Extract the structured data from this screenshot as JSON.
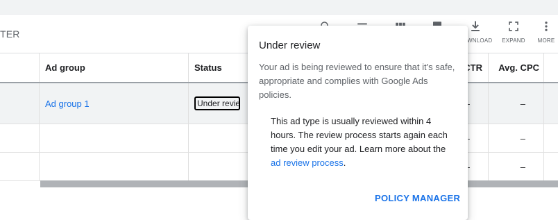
{
  "toolbar": {
    "filter_partial": "TER",
    "download_label": "DOWNLOAD",
    "expand_label": "EXPAND",
    "more_label": "MORE"
  },
  "table": {
    "headers": {
      "ad_group": "Ad group",
      "status": "Status",
      "ctr": "CTR",
      "avg_cpc": "Avg. CPC"
    },
    "rows": [
      {
        "ad_group": "Ad group 1",
        "status": "Under review",
        "ctr": "–",
        "avg_cpc": "–"
      },
      {
        "ad_group": "",
        "status": "",
        "ctr": "–",
        "avg_cpc": "–"
      },
      {
        "ad_group": "",
        "status": "",
        "ctr": "–",
        "avg_cpc": "–"
      }
    ]
  },
  "popup": {
    "title": "Under review",
    "description": "Your ad is being reviewed to ensure that it's safe, appropriate and complies with Google Ads policies.",
    "note_text": "This ad type is usually reviewed within 4 hours. The review process starts again each time you edit your ad. Learn more about the ",
    "note_link": "ad review process",
    "note_end": ".",
    "action_label": "POLICY MANAGER"
  },
  "colors": {
    "accent": "#1a73e8",
    "selected_row": "#f1f3f4",
    "scrollbar": "#b0b3b7"
  }
}
